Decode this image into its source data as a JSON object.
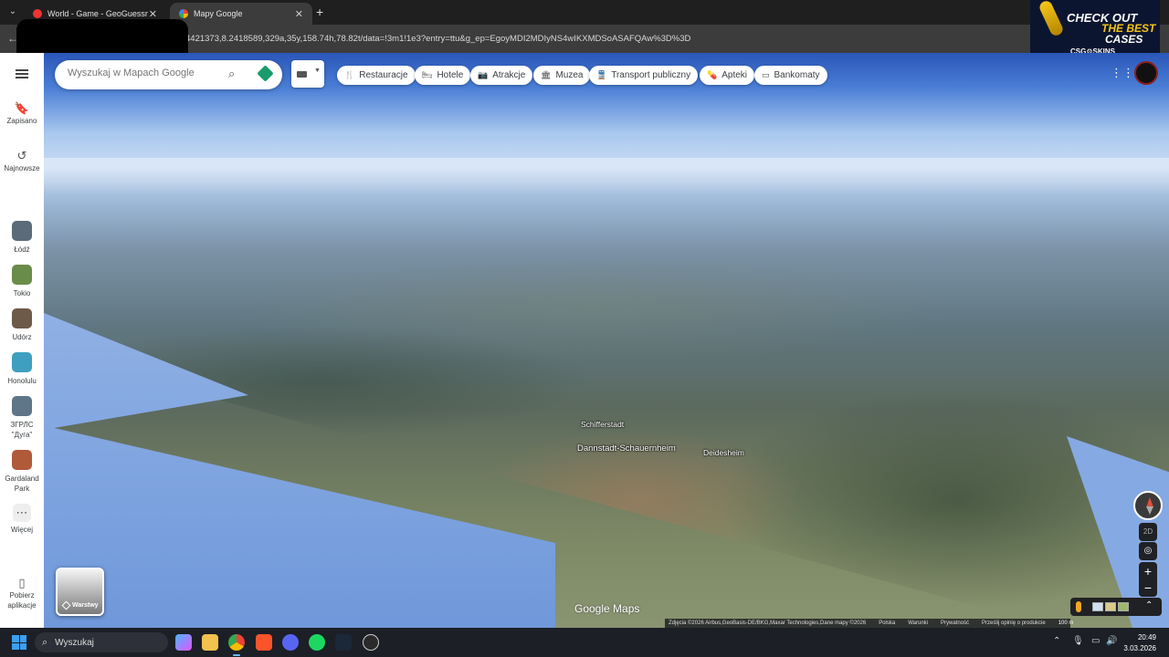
{
  "browser": {
    "tabs": [
      {
        "title": "World - Game - GeoGuessr",
        "close": "✕"
      },
      {
        "title": "Mapy Google",
        "close": "✕"
      }
    ],
    "new_tab": "+",
    "url": "4421373,8.2418589,329a,35y,158.74h,78.82t/data=!3m1!1e3?entry=ttu&g_ep=EgoyMDI2MDIyNS4wIKXMDSoASAFQAw%3D%3D"
  },
  "ad": {
    "line1a": "CHECK",
    "line1b": "OUT",
    "line2": "THE BEST",
    "line3": "CASES",
    "line4": "CSG⚙SKINS"
  },
  "sidebar": {
    "menu_label": "Menu",
    "saved": "Zapisano",
    "recent": "Najnowsze",
    "places": [
      {
        "label": "Łódź",
        "color": "#5b6b7a"
      },
      {
        "label": "Tokio",
        "color": "#6a8c4a"
      },
      {
        "label": "Udórz",
        "color": "#6e5a48"
      },
      {
        "label": "Honolulu",
        "color": "#3f9fc0"
      },
      {
        "label": "ЗГРЛС \"Дуга\"",
        "color": "#5f7588"
      },
      {
        "label": "Gardaland Park",
        "color": "#b05a3a"
      }
    ],
    "more": "Więcej",
    "get_app": "Pobierz aplikacje"
  },
  "search": {
    "placeholder": "Wyszukaj w Mapach Google"
  },
  "chips": [
    {
      "label": "Restauracje",
      "icon": "🍴"
    },
    {
      "label": "Hotele",
      "icon": "🛏"
    },
    {
      "label": "Atrakcje",
      "icon": "📷"
    },
    {
      "label": "Muzea",
      "icon": "🏛"
    },
    {
      "label": "Transport publiczny",
      "icon": "🚆"
    },
    {
      "label": "Apteki",
      "icon": "💊"
    },
    {
      "label": "Bankomaty",
      "icon": "▭"
    }
  ],
  "map": {
    "places": [
      "Schifferstadt",
      "Dannstadt-Schauernheim",
      "Deidesheim"
    ],
    "logo": "Google Maps",
    "layers_label": "Warstwy",
    "mode_2d": "2D",
    "zoom_in": "+",
    "zoom_out": "−",
    "attribution": {
      "imagery": "Zdjęcia ©2026 Airbus,GeoBasis-DE/BKG,Maxar Technologies,Dane mapy ©2026",
      "country": "Polska",
      "terms": "Warunki",
      "privacy": "Prywatność",
      "feedback": "Prześlij opinię o produkcie",
      "scale": "100 m"
    }
  },
  "taskbar": {
    "search": "Wyszukaj",
    "time": "20:49",
    "date": "3.03.2026"
  }
}
